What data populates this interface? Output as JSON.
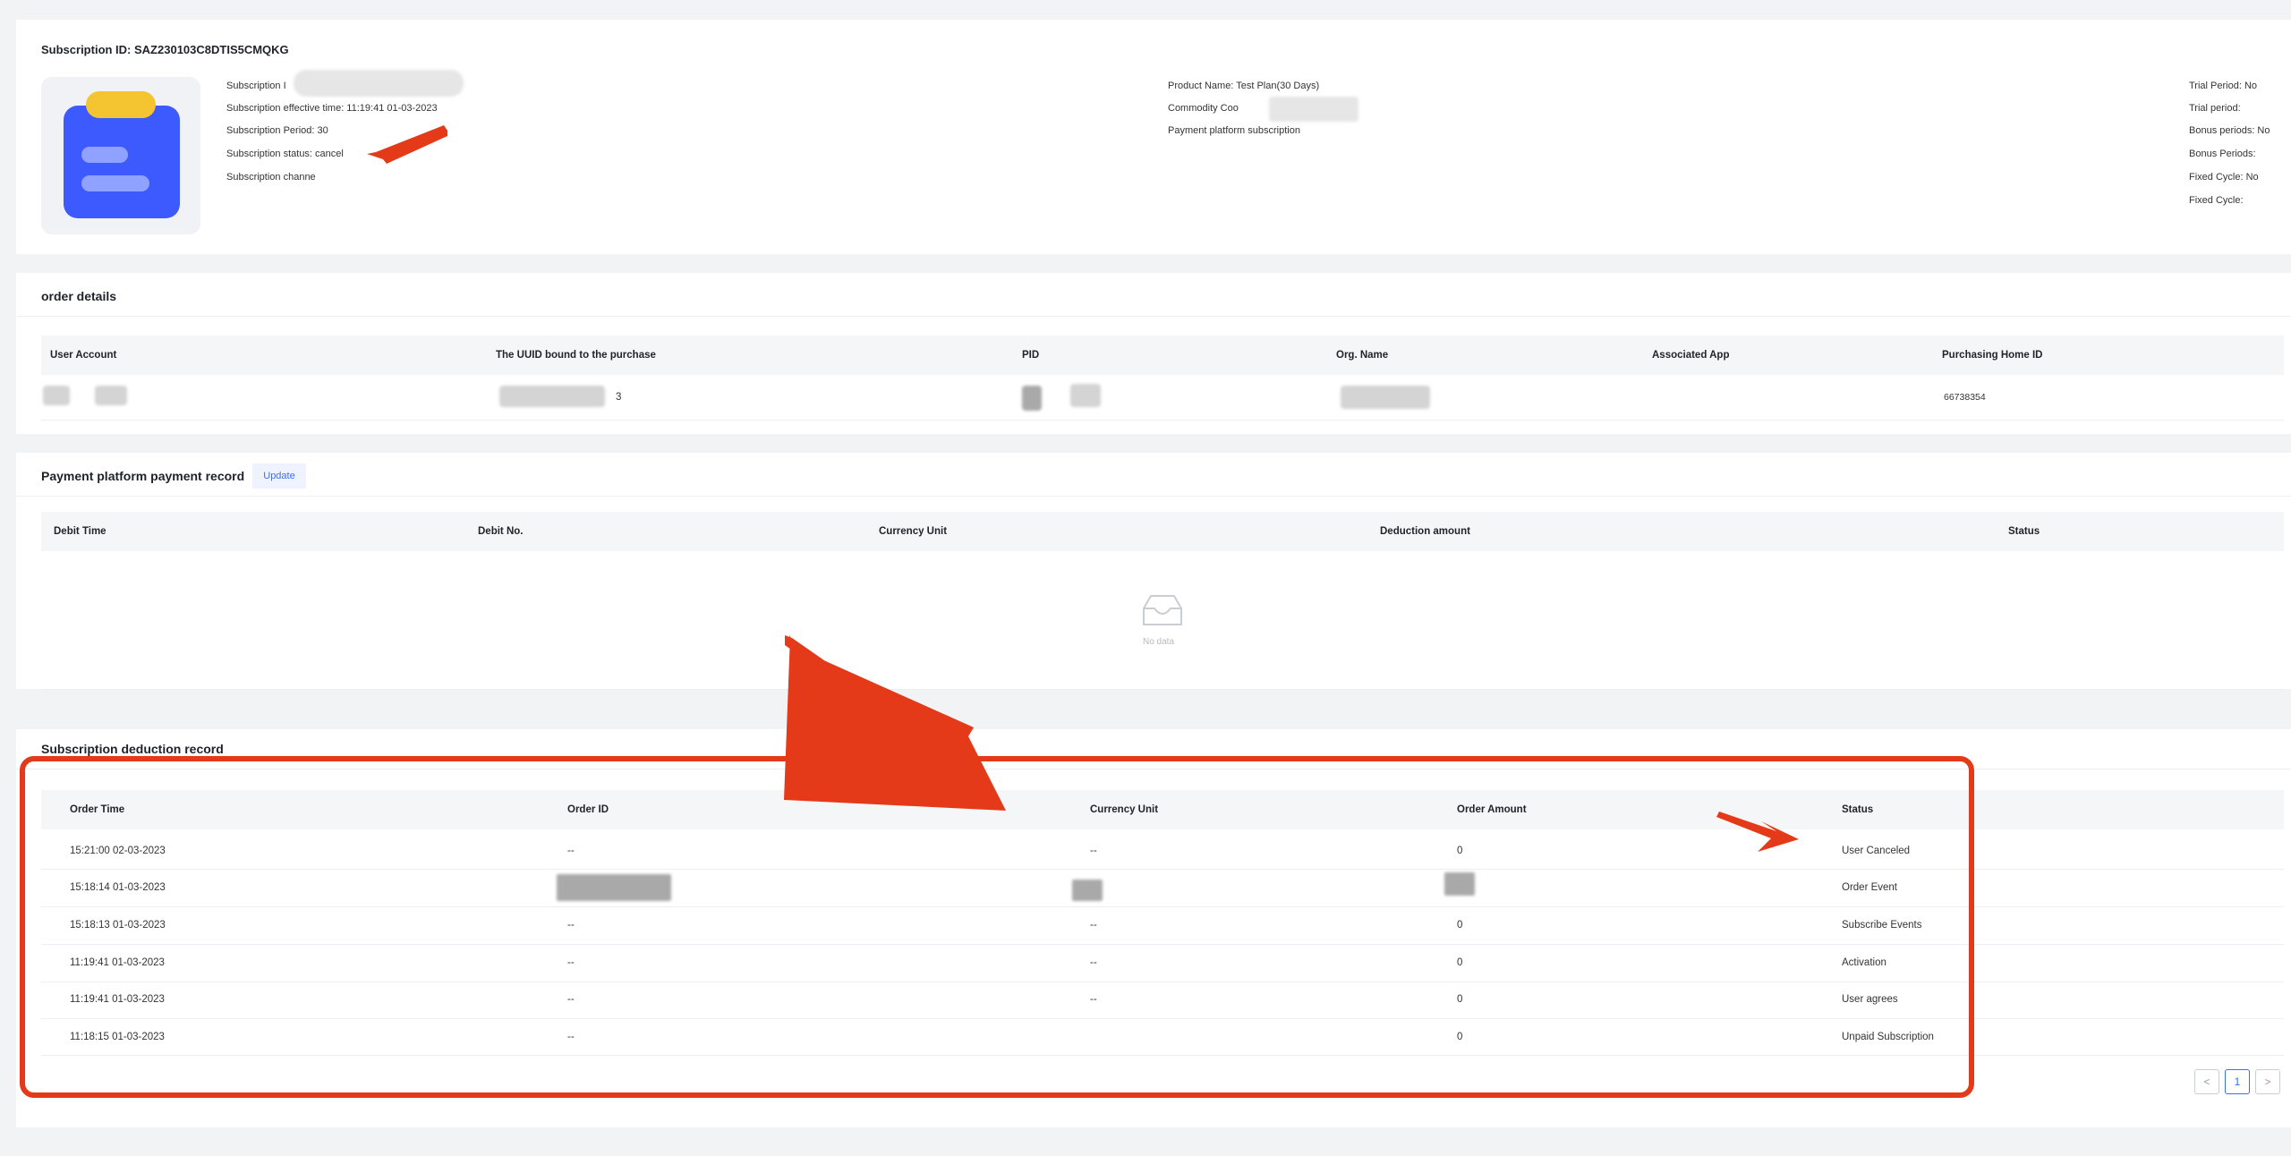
{
  "subscription": {
    "id_title": "Subscription ID: SAZ230103C8DTIS5CMQKG",
    "left_fields": [
      "Subscription I",
      "Subscription effective time: 11:19:41 01-03-2023",
      "Subscription Period: 30",
      "Subscription status: cancel",
      "Subscription channe"
    ],
    "mid_fields": [
      "Product Name: Test Plan(30 Days)",
      "Commodity Coo",
      "Payment platform subscription"
    ],
    "right_fields": [
      "Trial Period: No",
      "Trial period:",
      "Bonus periods: No",
      "Bonus Periods:",
      "Fixed Cycle: No",
      "Fixed Cycle:"
    ]
  },
  "order_details": {
    "title": "order details",
    "headers": [
      "User Account",
      "The UUID bound to the purchase",
      "PID",
      "Org. Name",
      "Associated App",
      "Purchasing Home ID"
    ],
    "row": {
      "uuid_suffix": "3",
      "purchasing_home_id": "66738354"
    }
  },
  "payment_record": {
    "title": "Payment platform payment record",
    "update_label": "Update",
    "headers": [
      "Debit Time",
      "Debit No.",
      "Currency Unit",
      "Deduction amount",
      "Status"
    ],
    "empty_text": "No data"
  },
  "deduction_record": {
    "title": "Subscription deduction record",
    "headers": [
      "Order Time",
      "Order ID",
      "Currency Unit",
      "Order Amount",
      "Status"
    ],
    "rows": [
      {
        "time": "15:21:00 02-03-2023",
        "order_id": "--",
        "currency": "--",
        "amount": "0",
        "status": "User Canceled"
      },
      {
        "time": "15:18:14 01-03-2023",
        "order_id": "",
        "currency": "",
        "amount": "",
        "status": "Order Event"
      },
      {
        "time": "15:18:13 01-03-2023",
        "order_id": "--",
        "currency": "--",
        "amount": "0",
        "status": "Subscribe Events"
      },
      {
        "time": "11:19:41 01-03-2023",
        "order_id": "--",
        "currency": "--",
        "amount": "0",
        "status": "Activation"
      },
      {
        "time": "11:19:41 01-03-2023",
        "order_id": "--",
        "currency": "--",
        "amount": "0",
        "status": "User agrees"
      },
      {
        "time": "11:18:15 01-03-2023",
        "order_id": "--",
        "currency": "",
        "amount": "0",
        "status": "Unpaid Subscription"
      }
    ]
  },
  "pagination": {
    "prev": "<",
    "current": "1",
    "next": ">"
  },
  "colors": {
    "accent": "#3370ff",
    "annotation_red": "#e53a1a",
    "app_icon_blue": "#3d5afe",
    "app_icon_yellow": "#f5c431"
  }
}
